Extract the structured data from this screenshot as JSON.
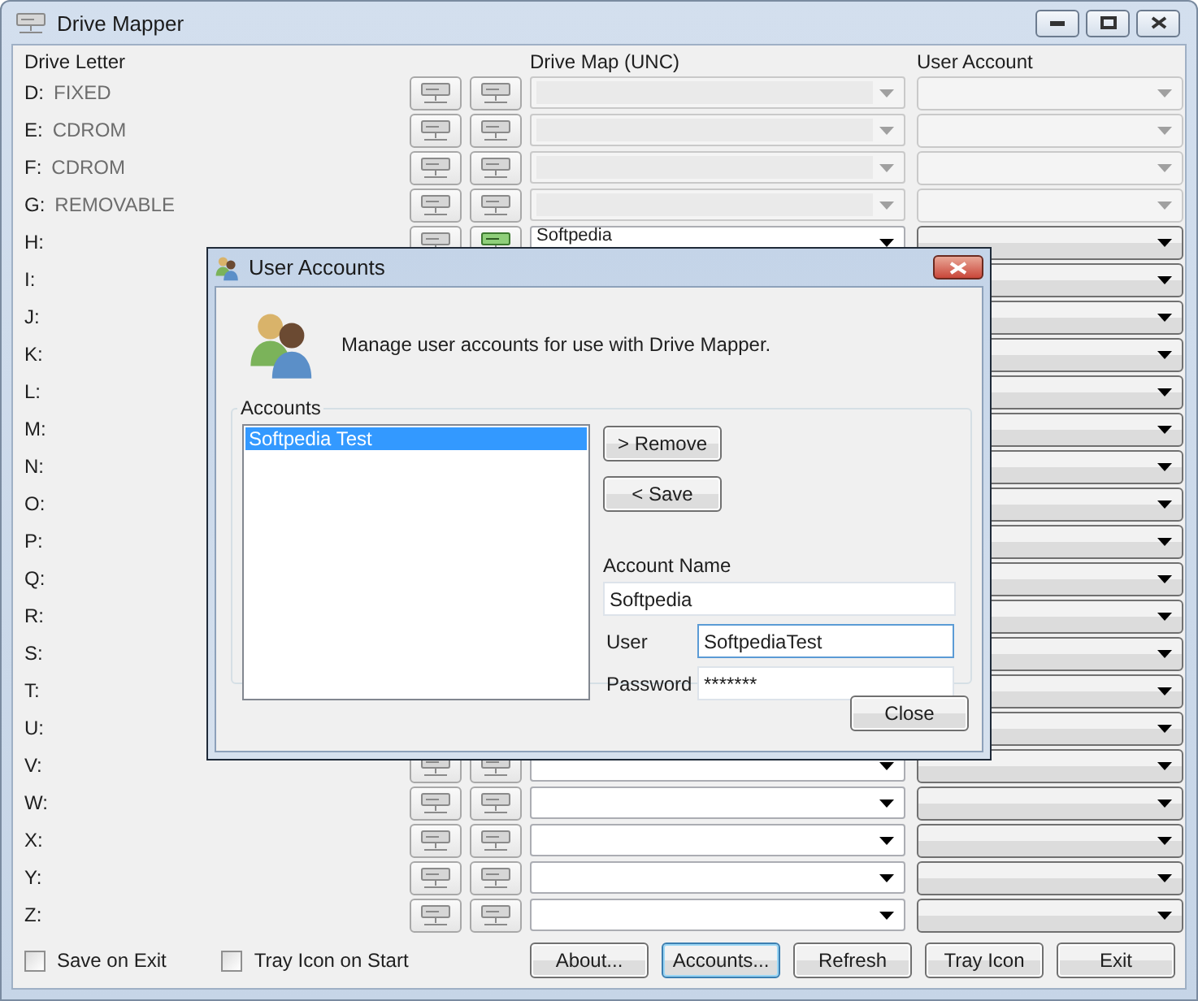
{
  "window": {
    "title": "Drive Mapper"
  },
  "columns": [
    "Drive Letter",
    "Drive Map (UNC)",
    "User Account"
  ],
  "drives": [
    {
      "letter": "D:",
      "type": "FIXED",
      "disabled": true,
      "connected": false
    },
    {
      "letter": "E:",
      "type": "CDROM",
      "disabled": true,
      "connected": false
    },
    {
      "letter": "F:",
      "type": "CDROM",
      "disabled": true,
      "connected": false
    },
    {
      "letter": "G:",
      "type": "REMOVABLE",
      "disabled": true,
      "connected": false
    },
    {
      "letter": "H:",
      "map": "Softpedia",
      "disabled": false,
      "connected": true
    },
    {
      "letter": "I:",
      "disabled": false
    },
    {
      "letter": "J:",
      "disabled": false
    },
    {
      "letter": "K:",
      "disabled": false
    },
    {
      "letter": "L:",
      "disabled": false
    },
    {
      "letter": "M:",
      "disabled": false
    },
    {
      "letter": "N:",
      "disabled": false
    },
    {
      "letter": "O:",
      "disabled": false
    },
    {
      "letter": "P:",
      "disabled": false
    },
    {
      "letter": "Q:",
      "disabled": false
    },
    {
      "letter": "R:",
      "disabled": false
    },
    {
      "letter": "S:",
      "disabled": false
    },
    {
      "letter": "T:",
      "disabled": false
    },
    {
      "letter": "U:",
      "disabled": false
    },
    {
      "letter": "V:",
      "disabled": false,
      "connected": false
    },
    {
      "letter": "W:",
      "disabled": false,
      "connected": false
    },
    {
      "letter": "X:",
      "disabled": false,
      "connected": false
    },
    {
      "letter": "Y:",
      "disabled": false,
      "connected": false
    },
    {
      "letter": "Z:",
      "disabled": false,
      "connected": false
    }
  ],
  "options": [
    {
      "label": "Save on Exit",
      "checked": false
    },
    {
      "label": "Tray Icon on Start",
      "checked": false
    }
  ],
  "buttons": [
    {
      "label": "About...",
      "focused": false
    },
    {
      "label": "Accounts...",
      "focused": true
    },
    {
      "label": "Refresh",
      "focused": false
    },
    {
      "label": "Tray Icon",
      "focused": false
    },
    {
      "label": "Exit",
      "focused": false
    }
  ],
  "dialog": {
    "title": "User Accounts",
    "message": "Manage user accounts for use with Drive Mapper.",
    "group": "Accounts",
    "accounts": [
      {
        "name": "Softpedia Test",
        "selected": true
      }
    ],
    "actions": [
      "> Remove",
      "< Save"
    ],
    "fields": [
      {
        "kind": "stacked",
        "label": "Account Name",
        "value": "Softpedia",
        "focused": false
      },
      {
        "kind": "inline",
        "label": "User",
        "value": "SoftpediaTest",
        "focused": true
      },
      {
        "kind": "inline",
        "label": "Password",
        "value": "*******",
        "focused": false
      }
    ],
    "close": "Close"
  }
}
